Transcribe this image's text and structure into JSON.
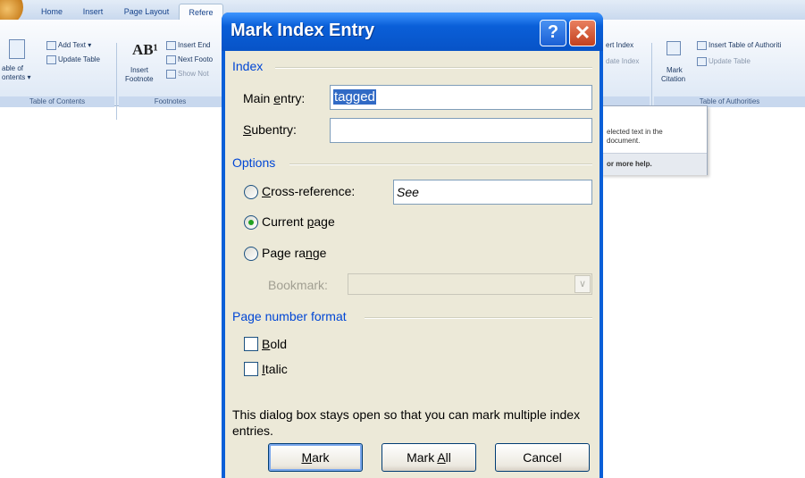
{
  "ribbon": {
    "tabs": [
      "Home",
      "Insert",
      "Page Layout",
      "Refere"
    ],
    "toc": {
      "add_text": "Add Text ▾",
      "update_table": "Update Table",
      "big_line1": "able of",
      "big_line2": "ontents ▾",
      "group": "Table of Contents"
    },
    "footnotes": {
      "insert_endnote": "Insert End",
      "next_footnote": "Next Footo",
      "show_notes": "Show Not",
      "insert_line1": "Insert",
      "insert_line2": "Footnote",
      "ab_icon": "AB¹",
      "group": "Footnotes"
    },
    "index": {
      "insert_index": "ert Index",
      "update_index": "date Index"
    },
    "authorities": {
      "insert_toa": "Insert Table of Authoriti",
      "update_table": "Update Table",
      "mark_line1": "Mark",
      "mark_line2": "Citation",
      "group": "Table of Authorities"
    },
    "popup": {
      "line1": "elected text in the",
      "line2": "document.",
      "line3": "or more help."
    }
  },
  "dialog": {
    "title": "Mark Index Entry",
    "help_glyph": "?",
    "close_glyph": "✕",
    "index_section": "Index",
    "main_entry_label_pre": "Main ",
    "main_entry_label_u": "e",
    "main_entry_label_post": "ntry:",
    "main_entry_value": "tagged",
    "subentry_label_u": "S",
    "subentry_label_post": "ubentry:",
    "subentry_value": "",
    "options_section": "Options",
    "cross_ref_label_u": "C",
    "cross_ref_label_post": "ross-reference:",
    "cross_ref_value": "See",
    "current_page_pre": "Current ",
    "current_page_u": "p",
    "current_page_post": "age",
    "page_range_pre": "Page ra",
    "page_range_u": "n",
    "page_range_post": "ge",
    "bookmark_label": "Bookmark:",
    "page_number_section": "Page number format",
    "bold_u": "B",
    "bold_post": "old",
    "italic_u": "I",
    "italic_post": "talic",
    "note": "This dialog box stays open so that you can mark multiple index entries.",
    "mark_u": "M",
    "mark_post": "ark",
    "mark_all_pre": "Mark ",
    "mark_all_u": "A",
    "mark_all_post": "ll",
    "cancel": "Cancel"
  }
}
